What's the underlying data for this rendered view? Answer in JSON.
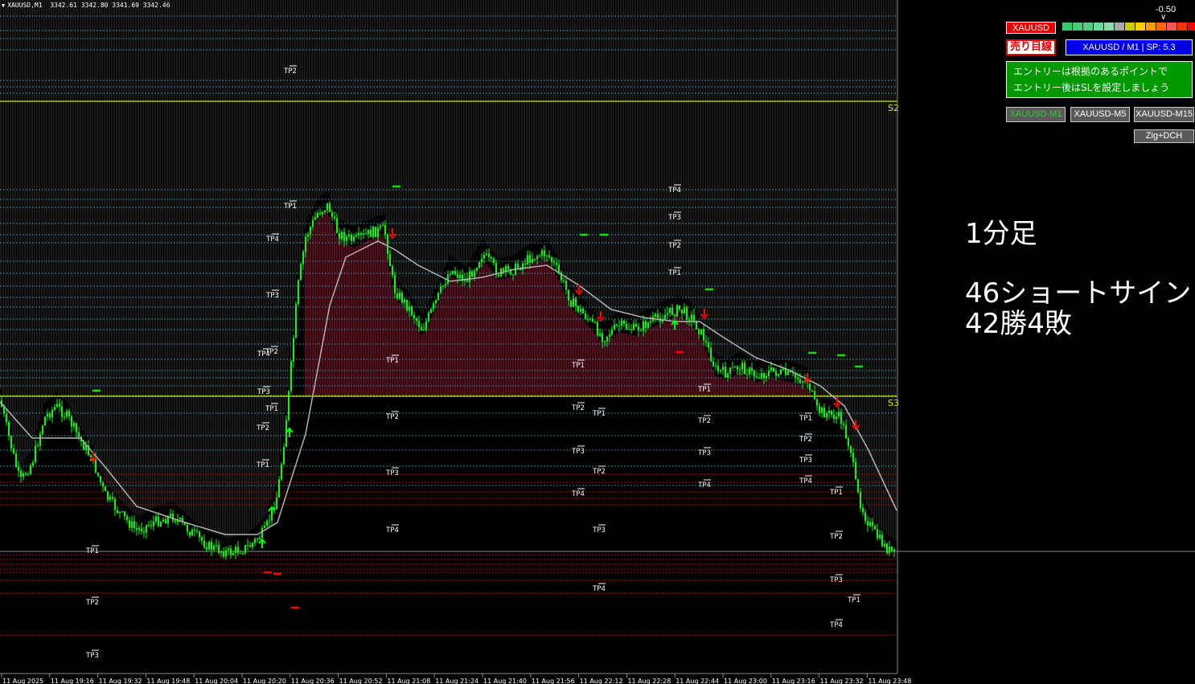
{
  "header": {
    "symbol": "XAUUSD,M1",
    "ohlc": "3342.61 3342.80 3341.69 3342.46"
  },
  "panel": {
    "symbol_label": "XAUUSD",
    "sell_label": "売り目線",
    "info": "XAUUSD / M1  |  SP: 5.3",
    "message_line1": "エントリーは根拠のあるポイントで",
    "message_line2": "エントリー後はSLを設定しましょう",
    "strength_value": "-0.50",
    "strength_colors": [
      "#33cc66",
      "#44cc77",
      "#55cc88",
      "#66dd99",
      "#88ddaa",
      "#aaaaaa",
      "#cccc00",
      "#ffcc00",
      "#ff9900",
      "#ff6600",
      "#ff5555",
      "#ff3300",
      "#ff0000"
    ],
    "tf_buttons": [
      {
        "label": "XAUUSD-M1",
        "active": true
      },
      {
        "label": "XAUUSD-M5",
        "active": false
      },
      {
        "label": "XAUUSD-M15",
        "active": false
      }
    ],
    "zig_button": "Zig+DCH"
  },
  "overlay": {
    "line1": "1分足",
    "line2": "46ショートサイン",
    "line3": "42勝4敗"
  },
  "levels": {
    "s2": "S2",
    "s3": "S3"
  },
  "time_axis": [
    "11 Aug 2025",
    "11 Aug 19:16",
    "11 Aug 19:32",
    "11 Aug 19:48",
    "11 Aug 20:04",
    "11 Aug 20:20",
    "11 Aug 20:36",
    "11 Aug 20:52",
    "11 Aug 21:08",
    "11 Aug 21:24",
    "11 Aug 21:40",
    "11 Aug 21:56",
    "11 Aug 22:12",
    "11 Aug 22:28",
    "11 Aug 22:44",
    "11 Aug 23:00",
    "11 Aug 23:16",
    "11 Aug 23:32",
    "11 Aug 23:48"
  ],
  "tp_labels": {
    "tp1": "TP1",
    "tp2": "TP2",
    "tp3": "TP3",
    "tp4": "TP4"
  },
  "colors": {
    "bull": "#00ff00",
    "bear": "#00ff00",
    "ma": "#b4b4b4",
    "sell_arrow": "#ff0000",
    "buy_arrow": "#00ff00",
    "level_line": "#c8e600",
    "sell_zone": "#5a0a1e"
  }
}
